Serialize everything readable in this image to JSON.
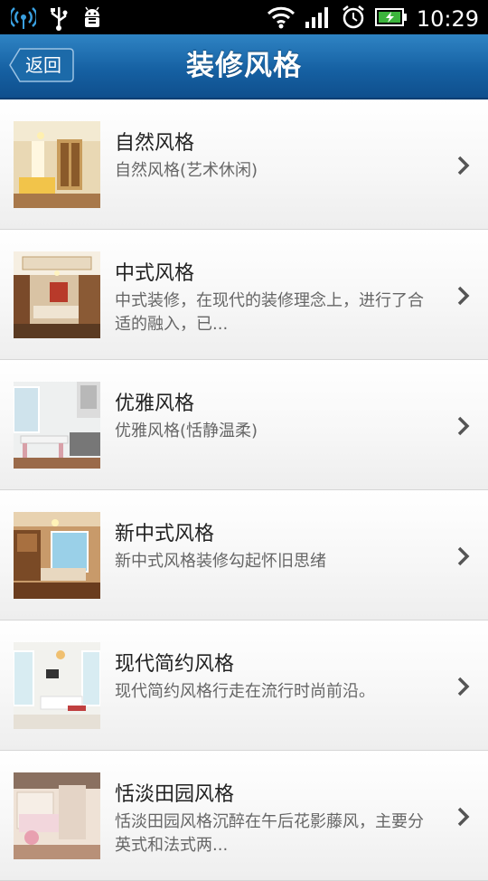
{
  "status_bar": {
    "time": "10:29",
    "icons": [
      "wifi-hotspot-icon",
      "usb-icon",
      "android-debug-icon",
      "wifi-signal-icon",
      "cell-signal-icon",
      "alarm-icon",
      "battery-charging-icon"
    ]
  },
  "header": {
    "back_label": "返回",
    "title": "装修风格",
    "bar_color": "#1a67a8"
  },
  "list": {
    "items": [
      {
        "title": "自然风格",
        "desc": "自然风格(艺术休闲)",
        "thumb": "living-room-photo"
      },
      {
        "title": "中式风格",
        "desc": "中式装修，在现代的装修理念上，进行了合适的融入，已...",
        "thumb": "living-room-photo"
      },
      {
        "title": "优雅风格",
        "desc": "优雅风格(恬静温柔)",
        "thumb": "kitchen-photo"
      },
      {
        "title": "新中式风格",
        "desc": "新中式风格装修勾起怀旧思绪",
        "thumb": "living-room-photo"
      },
      {
        "title": "现代简约风格",
        "desc": "现代简约风格行走在流行时尚前沿。",
        "thumb": "living-room-photo"
      },
      {
        "title": "恬淡田园风格",
        "desc": "恬淡田园风格沉醉在午后花影藤风，主要分英式和法式两...",
        "thumb": "bedroom-photo"
      }
    ]
  }
}
